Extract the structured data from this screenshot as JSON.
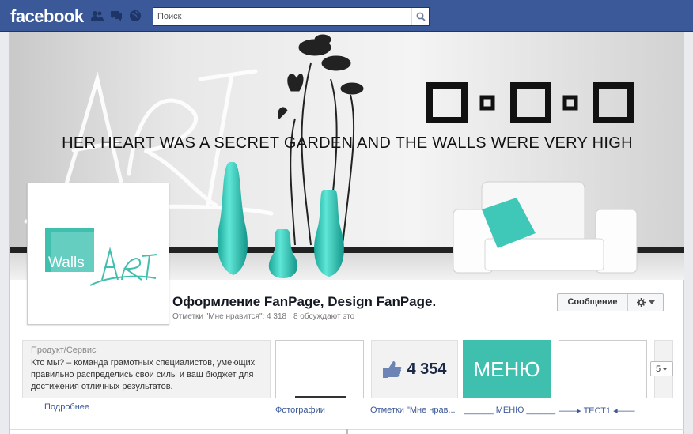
{
  "header": {
    "logo": "facebook",
    "search_placeholder": "Поиск",
    "icons": [
      "friends-icon",
      "messages-icon",
      "notifications-globe-icon",
      "search-icon"
    ]
  },
  "cover": {
    "quote": "HER HEART WAS A SECRET GARDEN AND THE WALLS WERE VERY HIGH",
    "script_word": "ART"
  },
  "profile": {
    "logo_word1": "Walls",
    "logo_word2": "ART",
    "brand_color": "#3fbfad"
  },
  "page": {
    "title": "Оформление FanPage, Design FanPage.",
    "stats": "Отметки \"Мне нравится\": 4 318 · 8 обсуждают это",
    "message_button": "Сообщение"
  },
  "about": {
    "category": "Продукт/Сервис",
    "text": "Кто мы? – команда грамотных специалистов, умеющих правильно распределись свои силы и ваш бюджет для достижения отличных результатов.",
    "more_link": "Подробнее"
  },
  "apps": {
    "photos_label": "Фотографии",
    "likes_count": "4 354",
    "likes_label": "Отметки \"Мне нрав...",
    "menu_text": "МЕНЮ",
    "menu_label": "______ МЕНЮ ______",
    "test_label": "——▸ ТЕСТ1 ◂——",
    "more_count": "5"
  },
  "colors": {
    "fb_blue": "#3b5998",
    "teal": "#3fbfad",
    "link": "#3b5998"
  }
}
